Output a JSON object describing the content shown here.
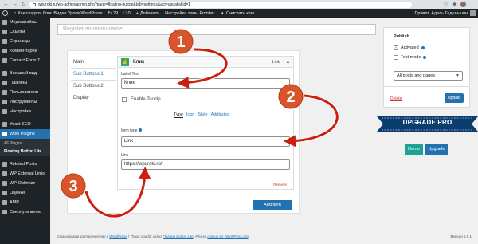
{
  "browser": {
    "url": "wpuroki.ru/wp-admin/admin.php?page=floating-button&tab=settings&act=update&id=1"
  },
  "adminbar": {
    "site": "Как создать блог. Видео Уроки WordPress",
    "updates": "29",
    "comments": "0",
    "add": "Добавить",
    "theme": "Настройка темы Frontier",
    "cache": "Очистить кэш",
    "greeting": "Привет, Адель Гадельшин"
  },
  "sidebar": {
    "items_top": [
      "Медиафайлы",
      "Ссылки",
      "Страницы",
      "Комментарии",
      "Contact Form 7"
    ],
    "items_mid": [
      "Внешний вид",
      "Плагины",
      "Пользователи",
      "Инструменты",
      "Настройки"
    ],
    "items_seo": [
      "Yoast SEO"
    ],
    "active": "Wow Plugins",
    "subitems": [
      "All Plugins",
      "Floating Button Lite"
    ],
    "items_bottom": [
      "Related Posts",
      "WP External Links",
      "WP-Optimize",
      "Оценки",
      "AMP"
    ],
    "collapse": "Свернуть меню"
  },
  "title_placeholder": "Register an menu name",
  "left_tabs": [
    "Main",
    "Sub Buttons 1",
    "Sub Buttons 2",
    "Display"
  ],
  "item": {
    "title": "Клик",
    "type_badge": "Link",
    "label_text_label": "Label Text",
    "label_text_value": "Клик",
    "enable_tooltip": "Enable Tooltip",
    "subtabs": [
      "Type",
      "Icon",
      "Style",
      "Attributes"
    ],
    "item_type_label": "Item type",
    "item_type_value": "Link",
    "link_label": "Link",
    "link_value": "https://wpuroki.ru/",
    "remove": "Remove"
  },
  "add_item": "Add item",
  "publish": {
    "title": "Publish",
    "activated": "Activated",
    "test_mode": "Test mode",
    "pages_select": "All posts and pages",
    "delete": "Delete",
    "update": "Update"
  },
  "upgrade": {
    "ribbon": "UPGRADE PRO",
    "demo": "Demo",
    "upgrade": "Upgrade"
  },
  "footer": {
    "t1": "Спасибо вам за творчество с",
    "l1": "WordPress",
    "t2": "| Thank you for using",
    "l2": "Floating Button Lite",
    "t3": "! Please",
    "l3": "rate us on WordPress.org",
    "version": "Версия 6.0.1"
  },
  "annotations": [
    "1",
    "2",
    "3"
  ],
  "colors": {
    "annotation_circle": "#d9542b",
    "annotation_arrow": "#cc1f10",
    "wp_blue": "#2271b1",
    "ribbon": "#0b3e6f"
  }
}
